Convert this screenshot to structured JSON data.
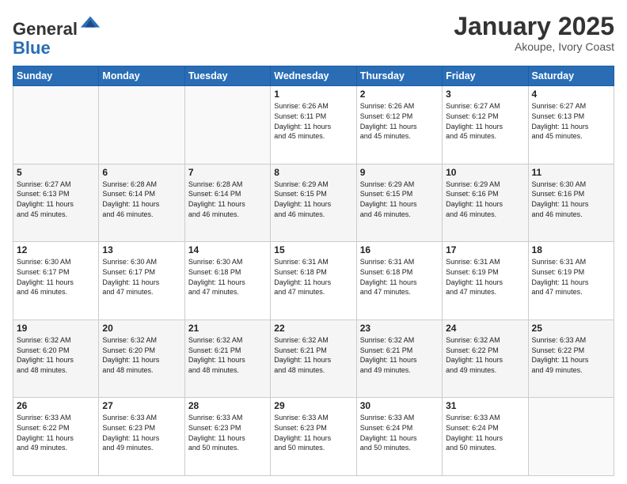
{
  "logo": {
    "general": "General",
    "blue": "Blue"
  },
  "header": {
    "month": "January 2025",
    "location": "Akoupe, Ivory Coast"
  },
  "weekdays": [
    "Sunday",
    "Monday",
    "Tuesday",
    "Wednesday",
    "Thursday",
    "Friday",
    "Saturday"
  ],
  "weeks": [
    [
      {
        "day": "",
        "info": ""
      },
      {
        "day": "",
        "info": ""
      },
      {
        "day": "",
        "info": ""
      },
      {
        "day": "1",
        "info": "Sunrise: 6:26 AM\nSunset: 6:11 PM\nDaylight: 11 hours\nand 45 minutes."
      },
      {
        "day": "2",
        "info": "Sunrise: 6:26 AM\nSunset: 6:12 PM\nDaylight: 11 hours\nand 45 minutes."
      },
      {
        "day": "3",
        "info": "Sunrise: 6:27 AM\nSunset: 6:12 PM\nDaylight: 11 hours\nand 45 minutes."
      },
      {
        "day": "4",
        "info": "Sunrise: 6:27 AM\nSunset: 6:13 PM\nDaylight: 11 hours\nand 45 minutes."
      }
    ],
    [
      {
        "day": "5",
        "info": "Sunrise: 6:27 AM\nSunset: 6:13 PM\nDaylight: 11 hours\nand 45 minutes."
      },
      {
        "day": "6",
        "info": "Sunrise: 6:28 AM\nSunset: 6:14 PM\nDaylight: 11 hours\nand 46 minutes."
      },
      {
        "day": "7",
        "info": "Sunrise: 6:28 AM\nSunset: 6:14 PM\nDaylight: 11 hours\nand 46 minutes."
      },
      {
        "day": "8",
        "info": "Sunrise: 6:29 AM\nSunset: 6:15 PM\nDaylight: 11 hours\nand 46 minutes."
      },
      {
        "day": "9",
        "info": "Sunrise: 6:29 AM\nSunset: 6:15 PM\nDaylight: 11 hours\nand 46 minutes."
      },
      {
        "day": "10",
        "info": "Sunrise: 6:29 AM\nSunset: 6:16 PM\nDaylight: 11 hours\nand 46 minutes."
      },
      {
        "day": "11",
        "info": "Sunrise: 6:30 AM\nSunset: 6:16 PM\nDaylight: 11 hours\nand 46 minutes."
      }
    ],
    [
      {
        "day": "12",
        "info": "Sunrise: 6:30 AM\nSunset: 6:17 PM\nDaylight: 11 hours\nand 46 minutes."
      },
      {
        "day": "13",
        "info": "Sunrise: 6:30 AM\nSunset: 6:17 PM\nDaylight: 11 hours\nand 47 minutes."
      },
      {
        "day": "14",
        "info": "Sunrise: 6:30 AM\nSunset: 6:18 PM\nDaylight: 11 hours\nand 47 minutes."
      },
      {
        "day": "15",
        "info": "Sunrise: 6:31 AM\nSunset: 6:18 PM\nDaylight: 11 hours\nand 47 minutes."
      },
      {
        "day": "16",
        "info": "Sunrise: 6:31 AM\nSunset: 6:18 PM\nDaylight: 11 hours\nand 47 minutes."
      },
      {
        "day": "17",
        "info": "Sunrise: 6:31 AM\nSunset: 6:19 PM\nDaylight: 11 hours\nand 47 minutes."
      },
      {
        "day": "18",
        "info": "Sunrise: 6:31 AM\nSunset: 6:19 PM\nDaylight: 11 hours\nand 47 minutes."
      }
    ],
    [
      {
        "day": "19",
        "info": "Sunrise: 6:32 AM\nSunset: 6:20 PM\nDaylight: 11 hours\nand 48 minutes."
      },
      {
        "day": "20",
        "info": "Sunrise: 6:32 AM\nSunset: 6:20 PM\nDaylight: 11 hours\nand 48 minutes."
      },
      {
        "day": "21",
        "info": "Sunrise: 6:32 AM\nSunset: 6:21 PM\nDaylight: 11 hours\nand 48 minutes."
      },
      {
        "day": "22",
        "info": "Sunrise: 6:32 AM\nSunset: 6:21 PM\nDaylight: 11 hours\nand 48 minutes."
      },
      {
        "day": "23",
        "info": "Sunrise: 6:32 AM\nSunset: 6:21 PM\nDaylight: 11 hours\nand 49 minutes."
      },
      {
        "day": "24",
        "info": "Sunrise: 6:32 AM\nSunset: 6:22 PM\nDaylight: 11 hours\nand 49 minutes."
      },
      {
        "day": "25",
        "info": "Sunrise: 6:33 AM\nSunset: 6:22 PM\nDaylight: 11 hours\nand 49 minutes."
      }
    ],
    [
      {
        "day": "26",
        "info": "Sunrise: 6:33 AM\nSunset: 6:22 PM\nDaylight: 11 hours\nand 49 minutes."
      },
      {
        "day": "27",
        "info": "Sunrise: 6:33 AM\nSunset: 6:23 PM\nDaylight: 11 hours\nand 49 minutes."
      },
      {
        "day": "28",
        "info": "Sunrise: 6:33 AM\nSunset: 6:23 PM\nDaylight: 11 hours\nand 50 minutes."
      },
      {
        "day": "29",
        "info": "Sunrise: 6:33 AM\nSunset: 6:23 PM\nDaylight: 11 hours\nand 50 minutes."
      },
      {
        "day": "30",
        "info": "Sunrise: 6:33 AM\nSunset: 6:24 PM\nDaylight: 11 hours\nand 50 minutes."
      },
      {
        "day": "31",
        "info": "Sunrise: 6:33 AM\nSunset: 6:24 PM\nDaylight: 11 hours\nand 50 minutes."
      },
      {
        "day": "",
        "info": ""
      }
    ]
  ]
}
